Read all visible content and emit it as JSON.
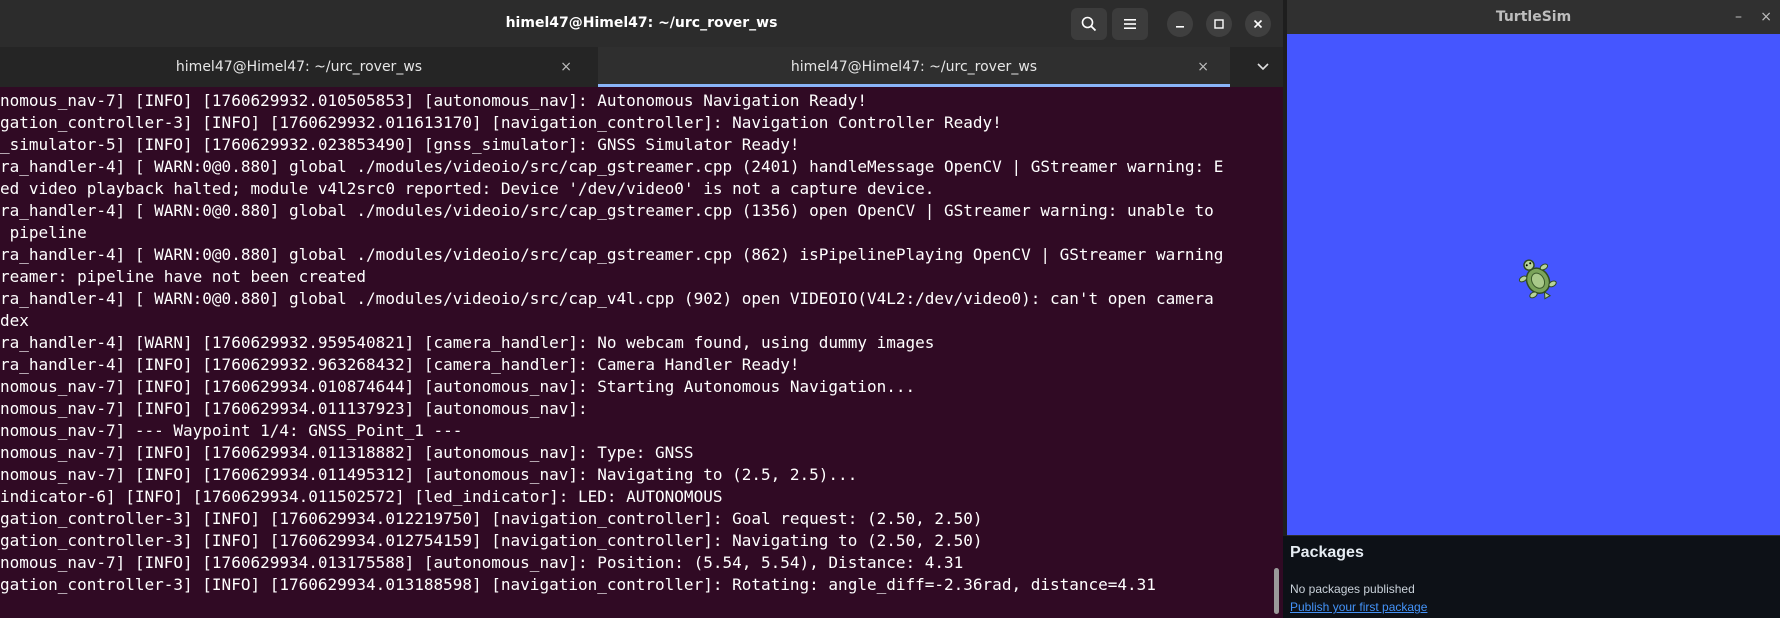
{
  "terminal": {
    "title": "himel47@Himel47: ~/urc_rover_ws",
    "tabs": [
      {
        "label": "himel47@Himel47: ~/urc_rover_ws",
        "active": false
      },
      {
        "label": "himel47@Himel47: ~/urc_rover_ws",
        "active": true
      }
    ],
    "tab_close": "×",
    "dropdown": "⌄",
    "icons": {
      "search": "search-icon",
      "menu": "hamburger-menu-icon",
      "minimize": "minimize-icon",
      "maximize": "maximize-icon",
      "close": "close-icon"
    },
    "lines": [
      "nomous_nav-7] [INFO] [1760629932.010505853] [autonomous_nav]: Autonomous Navigation Ready!",
      "gation_controller-3] [INFO] [1760629932.011613170] [navigation_controller]: Navigation Controller Ready!",
      "_simulator-5] [INFO] [1760629932.023853490] [gnss_simulator]: GNSS Simulator Ready!",
      "ra_handler-4] [ WARN:0@0.880] global ./modules/videoio/src/cap_gstreamer.cpp (2401) handleMessage OpenCV | GStreamer warning: E",
      "ed video playback halted; module v4l2src0 reported: Device '/dev/video0' is not a capture device.",
      "ra_handler-4] [ WARN:0@0.880] global ./modules/videoio/src/cap_gstreamer.cpp (1356) open OpenCV | GStreamer warning: unable to",
      " pipeline",
      "ra_handler-4] [ WARN:0@0.880] global ./modules/videoio/src/cap_gstreamer.cpp (862) isPipelinePlaying OpenCV | GStreamer warning",
      "reamer: pipeline have not been created",
      "ra_handler-4] [ WARN:0@0.880] global ./modules/videoio/src/cap_v4l.cpp (902) open VIDEOIO(V4L2:/dev/video0): can't open camera",
      "dex",
      "ra_handler-4] [WARN] [1760629932.959540821] [camera_handler]: No webcam found, using dummy images",
      "ra_handler-4] [INFO] [1760629932.963268432] [camera_handler]: Camera Handler Ready!",
      "nomous_nav-7] [INFO] [1760629934.010874644] [autonomous_nav]: Starting Autonomous Navigation...",
      "nomous_nav-7] [INFO] [1760629934.011137923] [autonomous_nav]:",
      "nomous_nav-7] --- Waypoint 1/4: GNSS_Point_1 ---",
      "nomous_nav-7] [INFO] [1760629934.011318882] [autonomous_nav]: Type: GNSS",
      "nomous_nav-7] [INFO] [1760629934.011495312] [autonomous_nav]: Navigating to (2.5, 2.5)...",
      "indicator-6] [INFO] [1760629934.011502572] [led_indicator]: LED: AUTONOMOUS",
      "gation_controller-3] [INFO] [1760629934.012219750] [navigation_controller]: Goal request: (2.50, 2.50)",
      "gation_controller-3] [INFO] [1760629934.012754159] [navigation_controller]: Navigating to (2.50, 2.50)",
      "nomous_nav-7] [INFO] [1760629934.013175588] [autonomous_nav]: Position: (5.54, 5.54), Distance: 4.31",
      "gation_controller-3] [INFO] [1760629934.013188598] [navigation_controller]: Rotating: angle_diff=-2.36rad, distance=4.31"
    ],
    "colors": {
      "background": "#300a24",
      "text": "#ffffff",
      "header": "#2c2c2c"
    }
  },
  "turtlesim": {
    "title": "TurtleSim",
    "minimize": "–",
    "close": "×",
    "canvas_color": "#4556ff",
    "turtle_icon": "turtle-icon"
  },
  "packages": {
    "title": "Packages",
    "empty_text": "No packages published",
    "link_text": "Publish your first package",
    "link_color": "#4493f8"
  }
}
